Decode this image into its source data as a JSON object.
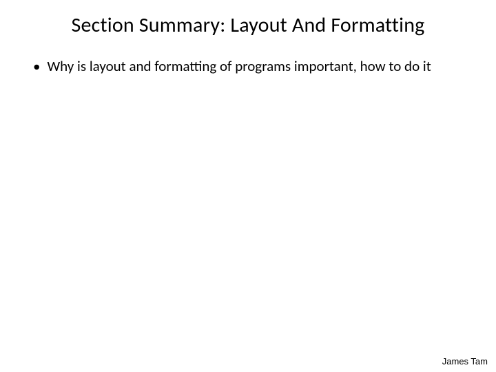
{
  "title": "Section Summary: Layout And Formatting",
  "bullets": [
    {
      "text": "Why is layout and formatting of programs important, how to do it"
    }
  ],
  "footer": "James Tam"
}
